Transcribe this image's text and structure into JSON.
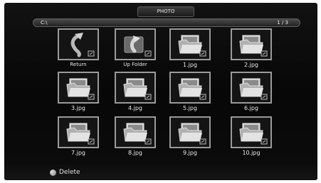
{
  "header": {
    "title": "PHOTO"
  },
  "pathbar": {
    "path": "C:\\",
    "page": "1 / 3"
  },
  "items": [
    {
      "label": "Return",
      "icon": "return-arrow-icon"
    },
    {
      "label": "Up Folder",
      "icon": "up-folder-icon"
    },
    {
      "label": "1.jpg",
      "icon": "photo-folder-icon"
    },
    {
      "label": "2.jpg",
      "icon": "photo-folder-icon"
    },
    {
      "label": "3.jpg",
      "icon": "photo-folder-icon"
    },
    {
      "label": "4.jpg",
      "icon": "photo-folder-icon"
    },
    {
      "label": "5.jpg",
      "icon": "photo-folder-icon"
    },
    {
      "label": "6.jpg",
      "icon": "photo-folder-icon"
    },
    {
      "label": "7.jpg",
      "icon": "photo-folder-icon"
    },
    {
      "label": "8.jpg",
      "icon": "photo-folder-icon"
    },
    {
      "label": "9.jpg",
      "icon": "photo-folder-icon"
    },
    {
      "label": "10.jpg",
      "icon": "photo-folder-icon"
    }
  ],
  "footer": {
    "delete_label": "Delete"
  }
}
